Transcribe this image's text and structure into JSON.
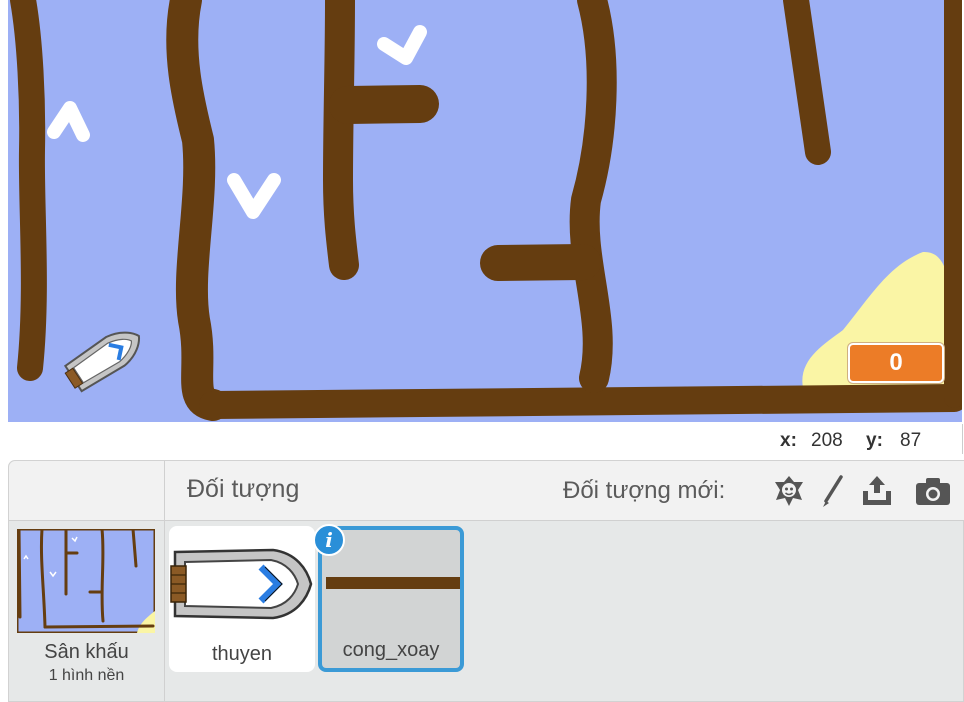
{
  "stage": {
    "score_value": "0",
    "colors": {
      "water": "#9db0f5",
      "wall": "#653d10",
      "sand": "#faf5a5",
      "monitor": "#ec7c27"
    }
  },
  "coords": {
    "x_label": "x:",
    "x_value": "208",
    "y_label": "y:",
    "y_value": "87"
  },
  "sprite_pane": {
    "title": "Đối tượng",
    "new_sprite_label": "Đối tượng mới:",
    "tools": [
      "choose-from-library-icon",
      "paint-brush-icon",
      "upload-icon",
      "camera-icon"
    ],
    "stage_item": {
      "label": "Sân khấu",
      "sublabel": "1 hình nền"
    },
    "sprites": [
      {
        "name": "thuyen",
        "selected": false
      },
      {
        "name": "cong_xoay",
        "selected": true
      }
    ],
    "info_symbol": "i"
  }
}
